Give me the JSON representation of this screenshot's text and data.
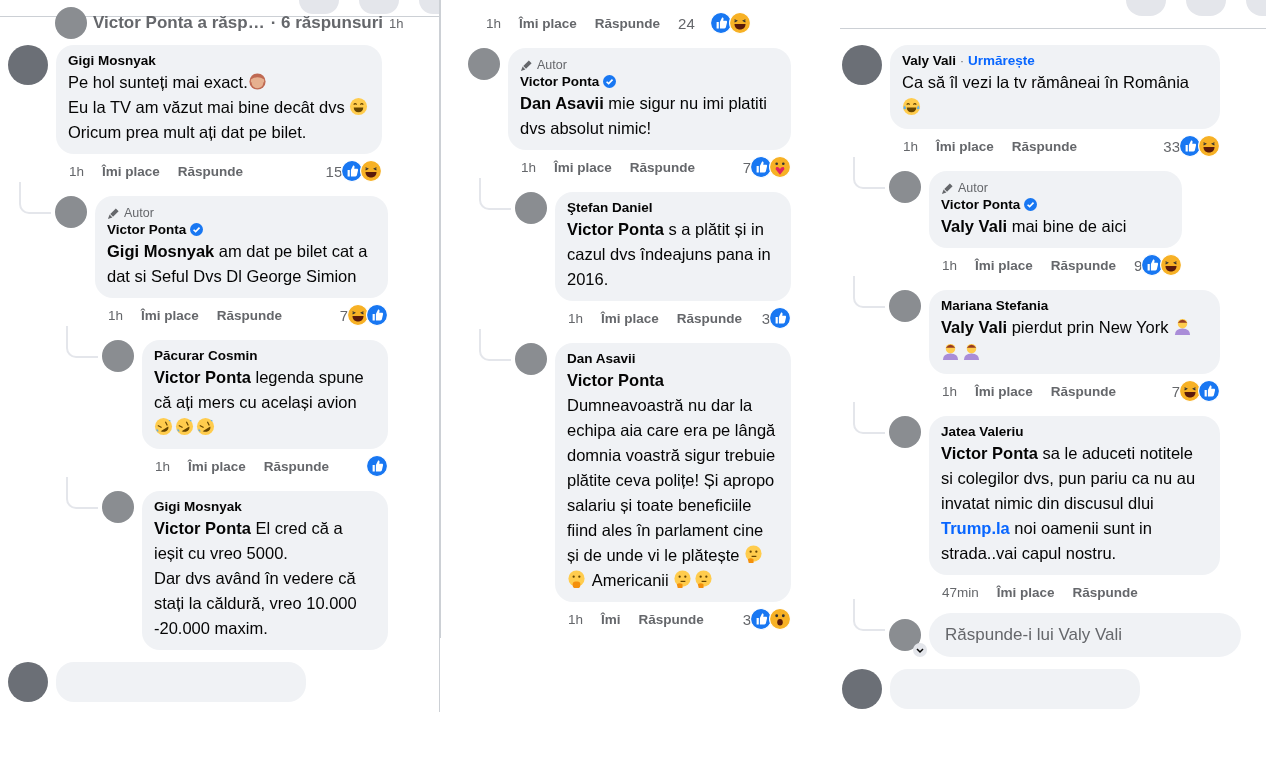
{
  "panels": [
    {
      "collapsed_row": {
        "text": "Victor Ponta a răsp…",
        "replies": "· 6 răspunsuri",
        "time": "1h"
      },
      "comments": [
        {
          "author": "Gigi Mosnyak",
          "parts": [
            {
              "kind": "text",
              "text": "Pe hol sunteți mai exact."
            },
            {
              "kind": "monkey"
            },
            {
              "kind": "break"
            },
            {
              "kind": "text",
              "text": "Eu la TV am văzut mai bine decât dvs "
            },
            {
              "kind": "grin"
            },
            {
              "kind": "break"
            },
            {
              "kind": "text",
              "text": "Oricum prea mult ați dat pe bilet."
            }
          ],
          "actions": {
            "time": "1h",
            "like": "Îmi place",
            "reply": "Răspunde",
            "count": "15",
            "reactions": [
              {
                "kind": "like"
              },
              {
                "kind": "haha"
              }
            ]
          },
          "children": [
            {
              "badge": "Autor",
              "author": "Victor Ponta",
              "verified": true,
              "parts": [
                {
                  "kind": "mention",
                  "text": "Gigi Mosnyak"
                },
                {
                  "kind": "text",
                  "text": " am dat pe bilet cat a dat si Seful Dvs Dl George Simion"
                }
              ],
              "actions": {
                "time": "1h",
                "like": "Îmi place",
                "reply": "Răspunde",
                "count": "7",
                "reactions": [
                  {
                    "kind": "haha"
                  },
                  {
                    "kind": "like"
                  }
                ]
              },
              "children": [
                {
                  "author": "Păcurar Cosmin",
                  "parts": [
                    {
                      "kind": "mention",
                      "text": "Victor Ponta"
                    },
                    {
                      "kind": "text",
                      "text": " legenda spune că ați mers cu același avion "
                    },
                    {
                      "kind": "rofl"
                    },
                    {
                      "kind": "rofl"
                    },
                    {
                      "kind": "rofl"
                    }
                  ],
                  "actions": {
                    "time": "1h",
                    "like": "Îmi place",
                    "reply": "Răspunde",
                    "reactions": [
                      {
                        "kind": "like"
                      }
                    ]
                  }
                },
                {
                  "author": "Gigi Mosnyak",
                  "parts": [
                    {
                      "kind": "mention",
                      "text": "Victor Ponta"
                    },
                    {
                      "kind": "text",
                      "text": " El cred că a ieșit cu vreo 5000."
                    },
                    {
                      "kind": "break"
                    },
                    {
                      "kind": "text",
                      "text": "Dar dvs având în vedere că stați la căldură, vreo 10.000 -20.000 maxim."
                    }
                  ]
                }
              ]
            }
          ]
        }
      ],
      "next_comment_cut": true
    },
    {
      "cut_actions": {
        "time": "1h",
        "like": "Îmi place",
        "reply": "Răspunde",
        "count": "24",
        "reactions": [
          {
            "kind": "like"
          },
          {
            "kind": "haha"
          }
        ]
      },
      "comments": [
        {
          "badge": "Autor",
          "author": "Victor Ponta",
          "verified": true,
          "parts": [
            {
              "kind": "mention",
              "text": "Dan Asavii"
            },
            {
              "kind": "text",
              "text": " mie sigur nu imi platiti dvs absolut nimic!"
            }
          ],
          "actions": {
            "time": "1h",
            "like": "Îmi place",
            "reply": "Răspunde",
            "count": "7",
            "reactions": [
              {
                "kind": "like"
              },
              {
                "kind": "care"
              }
            ]
          },
          "children": [
            {
              "author": "Ştefan Daniel",
              "parts": [
                {
                  "kind": "mention",
                  "text": "Victor Ponta"
                },
                {
                  "kind": "text",
                  "text": " s a plătit și in cazul dvs îndeajuns pana in 2016."
                }
              ],
              "actions": {
                "time": "1h",
                "like": "Îmi place",
                "reply": "Răspunde",
                "count": "3",
                "reactions": [
                  {
                    "kind": "like"
                  }
                ]
              }
            },
            {
              "author": "Dan Asavii",
              "parts": [
                {
                  "kind": "mention",
                  "text": "Victor Ponta"
                },
                {
                  "kind": "break"
                },
                {
                  "kind": "text",
                  "text": "Dumneavoastră nu dar la echipa aia care era pe lângă domnia voastră sigur trebuie plătite ceva polițe! Și apropo salariu și toate beneficiile fiind ales în parlament cine și de unde vi le plătește "
                },
                {
                  "kind": "think"
                },
                {
                  "kind": "gasp"
                },
                {
                  "kind": "text",
                  "text": " Americanii "
                },
                {
                  "kind": "think"
                },
                {
                  "kind": "think"
                }
              ],
              "actions": {
                "time": "1h",
                "like": "Îmi",
                "reply": "Răspunde",
                "count": "3",
                "reactions": [
                  {
                    "kind": "like"
                  },
                  {
                    "kind": "wow"
                  }
                ]
              }
            }
          ]
        }
      ]
    },
    {
      "comments": [
        {
          "author": "Valy Vali",
          "follow_separator": "·",
          "follow": "Urmărește",
          "parts": [
            {
              "kind": "text",
              "text": "Ca să îl vezi la tv rămâneai în România "
            },
            {
              "kind": "tears"
            }
          ],
          "actions": {
            "time": "1h",
            "like": "Îmi place",
            "reply": "Răspunde",
            "count": "33",
            "reactions": [
              {
                "kind": "like"
              },
              {
                "kind": "haha"
              }
            ]
          },
          "children": [
            {
              "badge": "Autor",
              "author": "Victor Ponta",
              "verified": true,
              "parts": [
                {
                  "kind": "mention",
                  "text": "Valy Vali"
                },
                {
                  "kind": "text",
                  "text": " mai bine de aici"
                }
              ],
              "actions": {
                "time": "1h",
                "like": "Îmi place",
                "reply": "Răspunde",
                "count": "9",
                "reactions": [
                  {
                    "kind": "like"
                  },
                  {
                    "kind": "haha"
                  }
                ]
              }
            },
            {
              "author": "Mariana Stefania",
              "parts": [
                {
                  "kind": "mention",
                  "text": "Valy Vali"
                },
                {
                  "kind": "text",
                  "text": " pierdut prin New York "
                },
                {
                  "kind": "person"
                },
                {
                  "kind": "person"
                },
                {
                  "kind": "person"
                }
              ],
              "actions": {
                "time": "1h",
                "like": "Îmi place",
                "reply": "Răspunde",
                "count": "7",
                "reactions": [
                  {
                    "kind": "haha"
                  },
                  {
                    "kind": "like"
                  }
                ]
              }
            },
            {
              "author": "Jatea Valeriu",
              "parts": [
                {
                  "kind": "mention",
                  "text": "Victor Ponta"
                },
                {
                  "kind": "text",
                  "text": " sa le aduceti notitele si colegilor dvs, pun pariu ca nu au invatat nimic din discusul dlui "
                },
                {
                  "kind": "link",
                  "text": "Trump.la"
                },
                {
                  "kind": "text",
                  "text": " noi oamenii sunt in strada..vai capul nostru."
                }
              ],
              "actions": {
                "time": "47min",
                "like": "Îmi place",
                "reply": "Răspunde"
              }
            }
          ]
        }
      ],
      "reply_field": {
        "placeholder": "Răspunde-i lui Valy Vali"
      },
      "next_comment_cut": true
    }
  ]
}
